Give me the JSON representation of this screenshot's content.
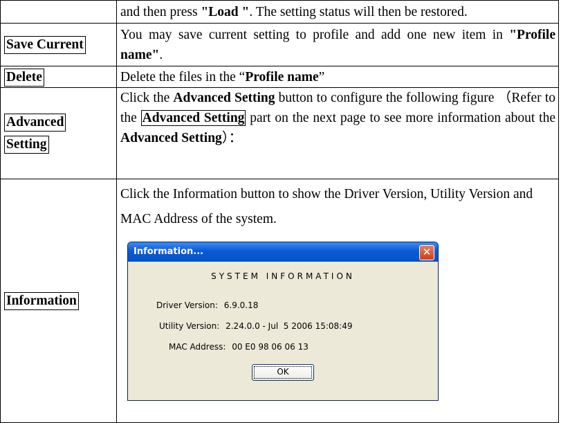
{
  "rows": [
    {
      "label": "",
      "text_parts": [
        "and then press ",
        "\"Load \"",
        ". The setting status will then be restored."
      ]
    },
    {
      "label": "Save Current",
      "text_parts": [
        "You may save current setting to profile and add one new item in ",
        "\"Profile name\"",
        "."
      ]
    },
    {
      "label": "Delete",
      "text_parts": [
        "Delete the files in the “",
        "Profile name",
        "”"
      ]
    },
    {
      "label_line1": "Advanced",
      "label_line2": "Setting",
      "text_parts": [
        "Click the ",
        "Advanced Setting",
        " button to configure the following figure （Refer to the ",
        "Advanced Setting",
        " part on the next page to see more information about the ",
        "Advanced Setting",
        "）："
      ]
    },
    {
      "label": "Information",
      "text": "Click the Information button to show the Driver Version, Utility Version and MAC Address of the system."
    }
  ],
  "dialog": {
    "title": "Information...",
    "close_glyph": "✕",
    "heading": "SYSTEM INFORMATION",
    "driver_label": "Driver Version:",
    "driver_value": "6.9.0.18",
    "utility_label": "Utility Version:",
    "utility_value": "2.24.0.0 - Jul  5 2006 15:08:49",
    "mac_label": "MAC Address:",
    "mac_value": "00 E0 98 06 06 13",
    "ok_label": "OK"
  }
}
